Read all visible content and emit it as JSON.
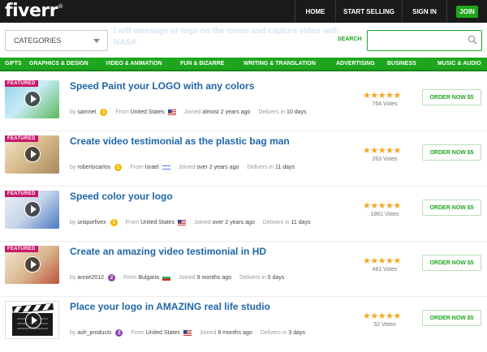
{
  "header": {
    "logo": "fiverr",
    "logo_mark": "®",
    "nav": [
      "HOME",
      "START SELLING",
      "SIGN IN"
    ],
    "join": "JOIN"
  },
  "search": {
    "category_label": "CATEGORIES",
    "ghost_line1": "I will message or logo on the moon and capture video with",
    "ghost_line2": "NASA",
    "label": "SEARCH",
    "placeholder": ""
  },
  "categories": [
    "GIFTS",
    "GRAPHICS & DESIGN",
    "VIDEO & ANIMATION",
    "FUN & BIZARRE",
    "WRITING & TRANSLATION",
    "ADVERTISING",
    "BUSINESS",
    "MUSIC & AUDIO"
  ],
  "common": {
    "featured": "FEATURED",
    "by": "by",
    "from": "From",
    "joined": "Joined",
    "delivers": "Delivers in",
    "order_label": "ORDER NOW $5"
  },
  "gigs": [
    {
      "featured": true,
      "title": "Speed Paint your LOGO with any colors",
      "seller": "samnet",
      "level": "1",
      "country": "United States",
      "joined": "almost 2 years ago",
      "delivers": "10 days",
      "rating": "★★★★★",
      "votes": "764 Votes"
    },
    {
      "featured": true,
      "title": "Create video testimonial as the plastic bag man",
      "seller": "robertocarlos",
      "level": "1",
      "country": "Israel",
      "joined": "over 2 years ago",
      "delivers": "11 days",
      "rating": "★★★★★",
      "votes": "263 Votes"
    },
    {
      "featured": true,
      "title": "Speed color your logo",
      "seller": "uniquefivex",
      "level": "1",
      "country": "United States",
      "joined": "over 2 years ago",
      "delivers": "11 days",
      "rating": "★★★★★",
      "votes": "1861 Votes"
    },
    {
      "featured": true,
      "title": "Create an amazing video testimonial in HD",
      "seller": "annie2012",
      "level": "2",
      "country": "Bulgaria",
      "joined": "9 months ago",
      "delivers": "5 days",
      "rating": "★★★★★",
      "votes": "481 Votes"
    },
    {
      "featured": false,
      "title": "Place your logo in AMAZING real life studio",
      "seller": "ash_products",
      "level": "2",
      "country": "United States",
      "joined": "8 months ago",
      "delivers": "3 days",
      "rating": "★★★★★",
      "votes": "52 Votes"
    }
  ],
  "colors": {
    "brand_green": "#1ea61e",
    "link_blue": "#1f66a8",
    "featured_pink": "#c8176a",
    "star_gold": "#f5a623",
    "level1": "#f2b705",
    "level2": "#8e44ad"
  },
  "icons": [
    "search-icon",
    "chevron-down-icon",
    "play-icon",
    "star-icon",
    "flag-icon"
  ]
}
